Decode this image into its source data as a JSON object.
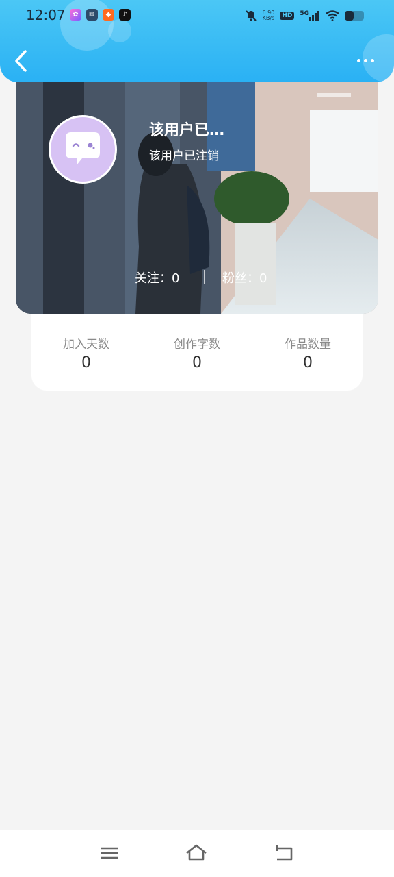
{
  "status_bar": {
    "time": "12:07",
    "net_speed_value": "6.90",
    "net_speed_unit": "KB/s",
    "hd_label": "HD",
    "network_label": "5G",
    "notification_icons": [
      "photo-app-icon",
      "message-app-icon",
      "app-icon",
      "tiktok-icon"
    ]
  },
  "header": {
    "back_icon": "chevron-left-icon",
    "more_icon": "more-dots-icon"
  },
  "profile": {
    "name": "该用户已…",
    "status": "该用户已注销",
    "follow": "关注：0",
    "fans": "粉丝：0",
    "avatar_icon": "chat-bubble-face-icon"
  },
  "stats": {
    "joined_days_label": "加入天数",
    "joined_days_value": "0",
    "words_label": "创作字数",
    "words_value": "0",
    "works_label": "作品数量",
    "works_value": "0"
  },
  "navbar": {
    "menu_icon": "menu-icon",
    "home_icon": "home-icon",
    "back_icon": "return-icon"
  },
  "colors": {
    "header": "#2ab1f4",
    "background": "#f4f4f4",
    "avatar": "#d7c2f4"
  }
}
